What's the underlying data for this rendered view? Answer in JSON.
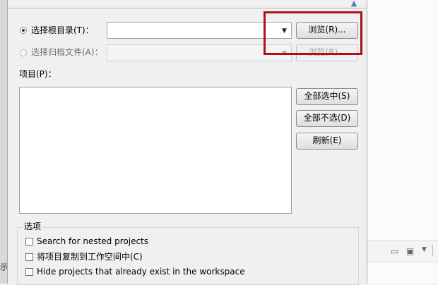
{
  "root_dir": {
    "label": "选择根目录(T)：",
    "value": "",
    "browse_label": "浏览(R)..."
  },
  "archive_file": {
    "label": "选择归档文件(A)：",
    "value": "",
    "browse_label": "浏览(R)..."
  },
  "projects": {
    "label": "项目(P)：",
    "items": [],
    "select_all_label": "全部选中(S)",
    "deselect_all_label": "全部不选(D)",
    "refresh_label": "刷新(E)"
  },
  "options": {
    "title": "选项",
    "nested_projects_label": "Search for nested projects",
    "copy_to_workspace_label": "将项目复制到工作空间中(C)",
    "hide_existing_label": "Hide projects that already exist in the workspace"
  },
  "background": {
    "edge_text": "示"
  },
  "colors": {
    "annotation_border": "#b01010"
  }
}
